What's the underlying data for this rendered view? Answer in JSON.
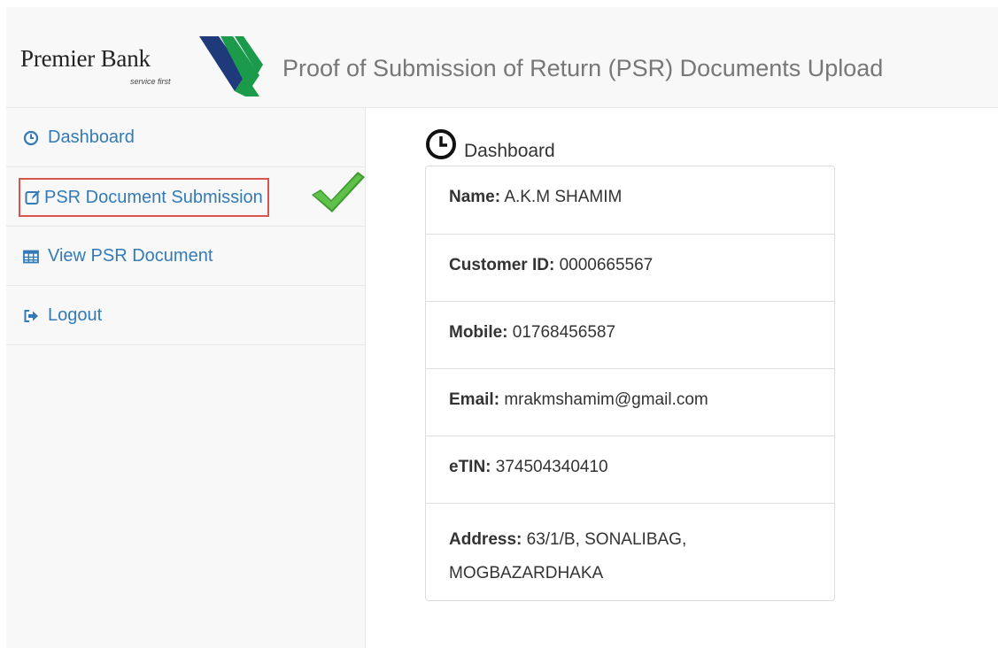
{
  "brand": {
    "name": "Premier Bank",
    "tagline": "service first",
    "colors": {
      "mark_dark": "#1f3a7a",
      "mark_green": "#1a9a4a"
    }
  },
  "header": {
    "title": "Proof of Submission of Return (PSR) Documents Upload"
  },
  "sidebar": {
    "items": [
      {
        "label": "Dashboard",
        "icon": "clock-icon"
      },
      {
        "label": "PSR Document Submission",
        "icon": "edit-icon",
        "highlighted": true
      },
      {
        "label": "View PSR Document",
        "icon": "table-icon"
      },
      {
        "label": "Logout",
        "icon": "logout-icon"
      }
    ]
  },
  "main": {
    "heading": "Dashboard",
    "heading_icon": "clock-icon",
    "profile": [
      {
        "label": "Name:",
        "value": "A.K.M SHAMIM"
      },
      {
        "label": "Customer ID:",
        "value": "0000665567"
      },
      {
        "label": "Mobile:",
        "value": "01768456587"
      },
      {
        "label": "Email:",
        "value": "mrakmshamim@gmail.com"
      },
      {
        "label": "eTIN:",
        "value": "374504340410"
      },
      {
        "label": "Address:",
        "value": "63/1/B, SONALIBAG, MOGBAZARDHAKA"
      }
    ]
  },
  "colors": {
    "link": "#337ab7",
    "highlight_border": "#d9534f",
    "checkmark": "#3d9b2f"
  }
}
